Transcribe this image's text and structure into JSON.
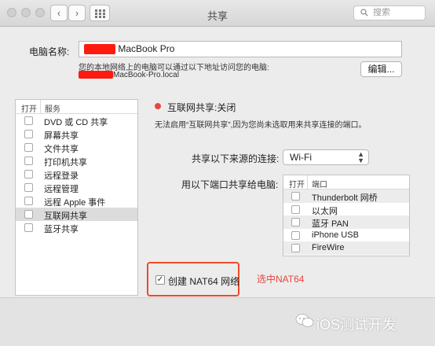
{
  "window": {
    "title": "共享"
  },
  "toolbar": {
    "back_icon": "chevron-left-icon",
    "forward_icon": "chevron-right-icon",
    "grid_icon": "grid-icon",
    "search_placeholder": "搜索"
  },
  "computer_name": {
    "label": "电脑名称:",
    "value": "MacBook Pro",
    "info": "您的本地网络上的电脑可以通过以下地址访问您的电脑:",
    "address": "MacBook-Pro.local",
    "edit_button": "编辑..."
  },
  "services": {
    "header_on": "打开",
    "header_service": "服务",
    "items": [
      {
        "label": "DVD 或 CD 共享",
        "checked": false,
        "selected": false
      },
      {
        "label": "屏幕共享",
        "checked": false,
        "selected": false
      },
      {
        "label": "文件共享",
        "checked": false,
        "selected": false
      },
      {
        "label": "打印机共享",
        "checked": false,
        "selected": false
      },
      {
        "label": "远程登录",
        "checked": false,
        "selected": false
      },
      {
        "label": "远程管理",
        "checked": false,
        "selected": false
      },
      {
        "label": "远程 Apple 事件",
        "checked": false,
        "selected": false
      },
      {
        "label": "互联网共享",
        "checked": false,
        "selected": true
      },
      {
        "label": "蓝牙共享",
        "checked": false,
        "selected": false
      }
    ]
  },
  "internet_sharing": {
    "status": "互联网共享:关闭",
    "status_color": "#e8463f",
    "description": "无法启用“互联网共享”,因为您尚未选取用来共享连接的端口。",
    "share_from_label": "共享以下来源的连接:",
    "share_from_value": "Wi-Fi",
    "share_to_label": "用以下端口共享给电脑:",
    "ports_header_on": "打开",
    "ports_header_port": "端口",
    "ports": [
      {
        "label": "Thunderbolt 网桥",
        "checked": false
      },
      {
        "label": "以太网",
        "checked": false
      },
      {
        "label": "蓝牙 PAN",
        "checked": false
      },
      {
        "label": "iPhone USB",
        "checked": false
      },
      {
        "label": "FireWire",
        "checked": false
      }
    ],
    "nat64": {
      "label": "创建 NAT64 网络",
      "checked": true,
      "checkmark": "✓"
    }
  },
  "annotation": {
    "text": "选中NAT64",
    "color": "#e8463f"
  },
  "watermark": {
    "text": "iOS测试开发"
  }
}
